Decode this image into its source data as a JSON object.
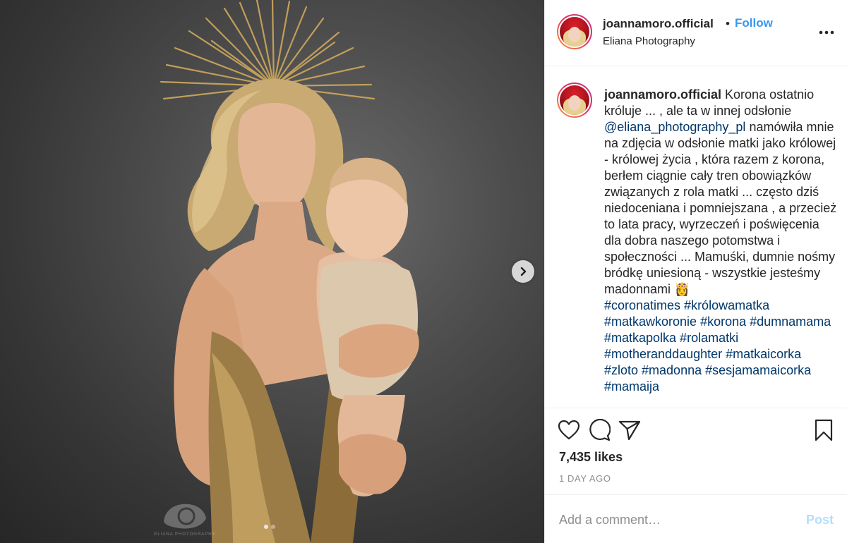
{
  "post": {
    "username": "joannamoro.official",
    "separator": "•",
    "follow_label": "Follow",
    "location": "Eliana Photography"
  },
  "caption": {
    "username": "joannamoro.official",
    "text_part1": " Korona ostatnio króluje ... , ale ta w innej odsłonie ",
    "mention": "@eliana_photography_pl",
    "text_part2": " namówiła mnie na zdjęcia w odsłonie matki jako królowej - królowej życia , która razem z korona, berłem ciągnie cały tren obowiązków związanych z rola matki ... często dziś niedoceniana i pomniejszana , a przecież to lata pracy, wyrzeczeń i poświęcenia dla dobra naszego potomstwa i społeczności ... Mamuśki, dumnie nośmy bródkę uniesioną - wszystkie jesteśmy madonnami 👸",
    "hashtags": "#coronatimes #królowamatka #matkawkoronie #korona #dumnamama #matkapolka #rolamatki #motheranddaughter #matkaicorka #zloto #madonna #sesjamamaicorka #mamaija"
  },
  "stats": {
    "likes": "7,435 likes",
    "time": "1 DAY AGO"
  },
  "comment": {
    "placeholder": "Add a comment…",
    "post_label": "Post"
  },
  "carousel": {
    "total": 2,
    "active": 1
  },
  "watermark": {
    "text": "ELIANA PHOTOGRAPHY"
  },
  "icons": {
    "more": "more-options-icon",
    "like": "heart-icon",
    "comment": "comment-bubble-icon",
    "share": "paper-plane-icon",
    "save": "bookmark-icon",
    "next": "chevron-right-icon"
  },
  "colors": {
    "accent": "#3897f0",
    "text": "#262626",
    "muted": "#8e8e8e",
    "link": "#00376b",
    "post_disabled": "#b2dffc",
    "border": "#efefef"
  }
}
